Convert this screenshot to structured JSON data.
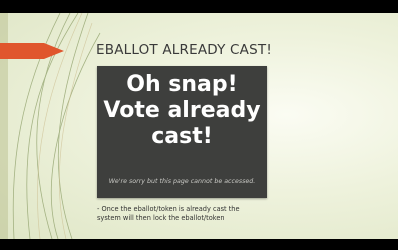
{
  "slide": {
    "title": "EBALLOT ALREADY CAST!",
    "card": {
      "headline_lines": [
        "Oh snap!",
        "Vote already",
        "cast!"
      ],
      "subtext": "We're sorry but this page cannot be accessed."
    },
    "note_lines": [
      "- Once the eballot/token is already cast the",
      "system will then lock the eballot/token"
    ]
  },
  "colors": {
    "accent_arrow": "#e0562d",
    "card_background": "#3e3f3d",
    "slide_background": "#eef2dc",
    "decor_lines": "#8fa06a"
  },
  "icons": [
    "arrow-decoration-icon"
  ]
}
